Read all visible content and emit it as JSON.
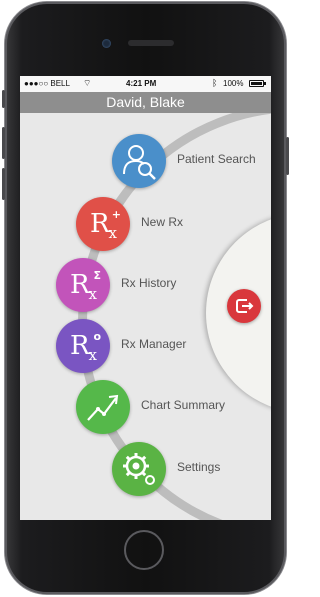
{
  "status_bar": {
    "carrier": "●●●○○ BELL",
    "time": "4:21 PM",
    "battery": "100%"
  },
  "header": {
    "title": "David, Blake"
  },
  "menu": {
    "items": [
      {
        "label": "Patient Search",
        "color": "#4a8fca",
        "icon": "patient-search-icon"
      },
      {
        "label": "New Rx",
        "color": "#e05048",
        "icon": "rx-plus-icon"
      },
      {
        "label": "Rx History",
        "color": "#c254ba",
        "icon": "rx-history-icon"
      },
      {
        "label": "Rx Manager",
        "color": "#7a55c2",
        "icon": "rx-manager-icon"
      },
      {
        "label": "Chart Summary",
        "color": "#55b84a",
        "icon": "chart-trend-icon"
      },
      {
        "label": "Settings",
        "color": "#5ab344",
        "icon": "gear-icon"
      }
    ]
  },
  "logout": {
    "color": "#d9373c",
    "icon": "logout-icon"
  }
}
